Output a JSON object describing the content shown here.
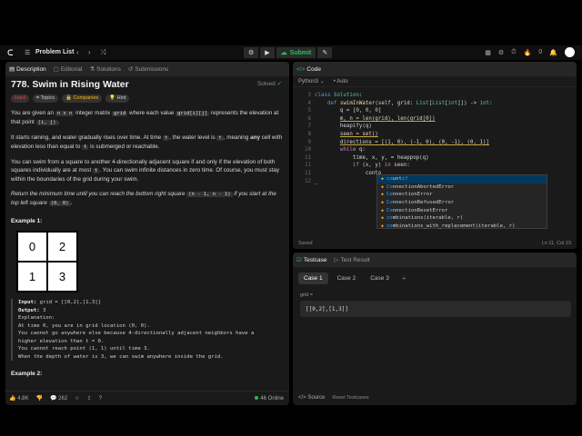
{
  "topbar": {
    "problem_list": "Problem List",
    "submit": "Submit",
    "notifications": "0"
  },
  "left": {
    "tabs": [
      {
        "label": "Description"
      },
      {
        "label": "Editorial"
      },
      {
        "label": "Solutions"
      },
      {
        "label": "Submissions"
      }
    ],
    "title": "778. Swim in Rising Water",
    "solved": "Solved",
    "badges": {
      "difficulty": "Hard",
      "topics": "Topics",
      "companies": "Companies",
      "hint": "Hint"
    },
    "desc": {
      "p1a": "You are given an ",
      "p1c1": "n x n",
      "p1b": " integer matrix ",
      "p1c2": "grid",
      "p1d": " where each value ",
      "p1c3": "grid[i][j]",
      "p1e": " represents the elevation at that point ",
      "p1c4": "(i, j)",
      "p1f": ".",
      "p2a": "It starts raining, and water gradually rises over time. At time ",
      "p2c1": "t",
      "p2b": ", the water level is ",
      "p2c2": "t",
      "p2c": ", meaning ",
      "p2any": "any",
      "p2d": " cell with elevation less than equal to ",
      "p2c3": "t",
      "p2e": " is submerged or reachable.",
      "p3a": "You can swim from a square to another 4-directionally adjacent square if and only if the elevation of both squares individually are at most ",
      "p3c1": "t",
      "p3b": ". You can swim infinite distances in zero time. Of course, you must stay within the boundaries of the grid during your swim.",
      "p4a": "Return the minimum time until you can reach the bottom right square ",
      "p4c1": "(n - 1, n - 1)",
      "p4b": " if you start at the top left square ",
      "p4c2": "(0, 0)",
      "p4c": "."
    },
    "example1": {
      "title": "Example 1:",
      "cells": [
        "0",
        "2",
        "1",
        "3"
      ],
      "input_label": "Input:",
      "input": " grid = [[0,2],[1,3]]",
      "output_label": "Output:",
      "output": " 3",
      "explanation": "Explanation:\nAt time 0, you are in grid location (0, 0).\nYou cannot go anywhere else because 4-directionally adjacent neighbors have a\nhigher elevation than t = 0.\nYou cannot reach point (1, 1) until time 3.\nWhen the depth of water is 3, we can swim anywhere inside the grid."
    },
    "example2_title": "Example 2:",
    "footer": {
      "likes": "4.8K",
      "comments": "262",
      "online": "46 Online"
    }
  },
  "code": {
    "tab": "Code",
    "language": "Python3",
    "auto": "Auto",
    "lines": [
      {
        "n": "3",
        "html": "<span class=\"kw2\">class</span> <span class=\"ty\">Solution</span>:"
      },
      {
        "n": "4",
        "html": "    <span class=\"kw2\">def</span> <span class=\"fn\">swimInWater</span>(self, grid: <span class=\"ty\">List</span>[<span class=\"ty\">List</span>[<span class=\"ty\">int</span>]]) -&gt; <span class=\"ty\">int</span>:"
      },
      {
        "n": "5",
        "html": "        q = [<span class=\"nm\">0</span>, <span class=\"nm\">0</span>, <span class=\"nm\">0</span>]"
      },
      {
        "n": "6",
        "html": "        <span class=\"ul\">m, n = len(grid), len(grid[0])</span>"
      },
      {
        "n": "7",
        "html": "        heapify(q)"
      },
      {
        "n": "8",
        "html": "        <span class=\"ul\">seen = set()</span>"
      },
      {
        "n": "9",
        "html": "        <span class=\"ul\">directions = [(1, 0), (-1, 0), (0, -1), (0, 1)]</span>"
      },
      {
        "n": "10",
        "html": "        <span class=\"kw\">while</span> q:"
      },
      {
        "n": "11",
        "html": "            time, x, y, = heappop(q)"
      },
      {
        "n": "11",
        "html": "            <span class=\"kw\">if</span> (x, y) <span class=\"kw\">in</span> seen:"
      },
      {
        "n": "11",
        "html": "                conto"
      },
      {
        "n": "12",
        "html": "_"
      }
    ],
    "autocomplete": [
      {
        "prefix": "co",
        "rest": "unt",
        "suffix": "if"
      },
      {
        "prefix": "Co",
        "rest": "nnectionAbortedError",
        "suffix": ""
      },
      {
        "prefix": "Co",
        "rest": "nnectionError",
        "suffix": ""
      },
      {
        "prefix": "Co",
        "rest": "nnectionRefusedError",
        "suffix": ""
      },
      {
        "prefix": "Co",
        "rest": "nnectionResetError",
        "suffix": ""
      },
      {
        "prefix": "co",
        "rest": "mbinations(iterable, r)",
        "suffix": ""
      },
      {
        "prefix": "co",
        "rest": "mbinations_with_replacement(iterable, r)",
        "suffix": ""
      }
    ],
    "status_left": "Saved",
    "status_right": "Ln 11, Col 23"
  },
  "tests": {
    "tabs": [
      {
        "label": "Testcase"
      },
      {
        "label": "Test Result"
      }
    ],
    "cases": [
      "Case 1",
      "Case 2",
      "Case 3"
    ],
    "label": "grid =",
    "value": "[[0,2],[1,3]]",
    "footer_source": "Source",
    "footer_reset": "Reset Testcases"
  }
}
